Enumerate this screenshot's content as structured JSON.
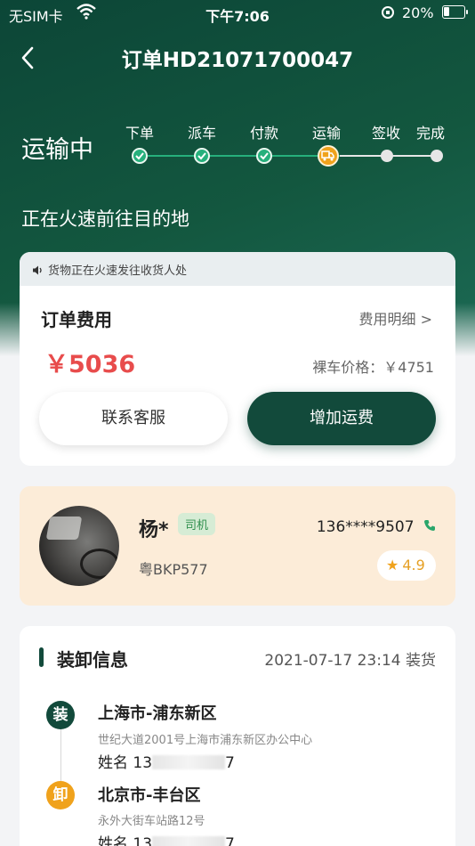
{
  "status_bar": {
    "carrier": "无SIM卡",
    "time": "下午7:06",
    "battery": "20%"
  },
  "nav": {
    "title": "订单HD21071700047"
  },
  "progress": {
    "stage": "运输中",
    "steps": [
      "下单",
      "派车",
      "付款",
      "运输",
      "签收",
      "完成"
    ],
    "current_index": 3,
    "sub_status": "正在火速前往目的地"
  },
  "fee_card": {
    "notice": "货物正在火速发往收货人处",
    "title": "订单费用",
    "detail_link": "费用明细 >",
    "amount": "￥5036",
    "bare_price": "裸车价格：￥4751",
    "service_button": "联系客服",
    "add_fee_button": "增加运费"
  },
  "driver": {
    "name": "杨*",
    "role": "司机",
    "phone": "136****9507",
    "plate": "粤BKP577",
    "rating": "4.9"
  },
  "loading": {
    "title": "装卸信息",
    "time": "2021-07-17 23:14 装货",
    "load_badge": "装",
    "load_city": "上海市-浦东新区",
    "load_address": "世纪大道2001号上海市浦东新区办公中心",
    "load_contact_prefix": "姓名 13",
    "load_contact_suffix": "7",
    "unload_badge": "卸",
    "unload_city": "北京市-丰台区",
    "unload_address": "永外大街车站路12号",
    "unload_contact_prefix": "姓名 13",
    "unload_contact_suffix": "7"
  },
  "colors": {
    "brand_dark": "#124a3b",
    "accent_green": "#26b07c",
    "accent_orange": "#f0a21c",
    "price_red": "#e84c4c"
  }
}
